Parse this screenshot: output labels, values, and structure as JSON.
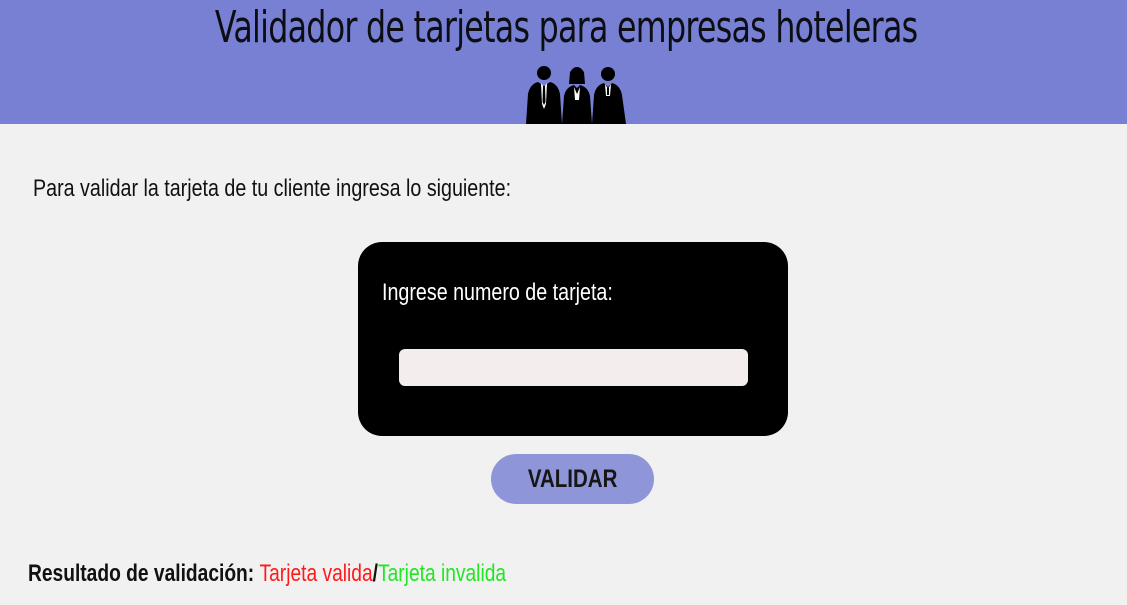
{
  "header": {
    "title": "Validador de tarjetas para empresas hoteleras",
    "logo_icon": "business-people-silhouette-icon",
    "background_color": "#7780d3"
  },
  "main": {
    "intro_text": "Para validar la tarjeta de tu cliente ingresa lo siguiente:",
    "card_form": {
      "label": "Ingrese numero de tarjeta:",
      "input_value": "",
      "input_placeholder": ""
    },
    "validate_button_label": "VALIDAR",
    "validate_button_color": "#8e95d8"
  },
  "result": {
    "label": "Resultado de validación:",
    "valid_text": "Tarjeta valida",
    "separator": "/",
    "invalid_text": "Tarjeta invalida",
    "valid_color": "#ff1a1a",
    "invalid_color": "#22e622"
  }
}
